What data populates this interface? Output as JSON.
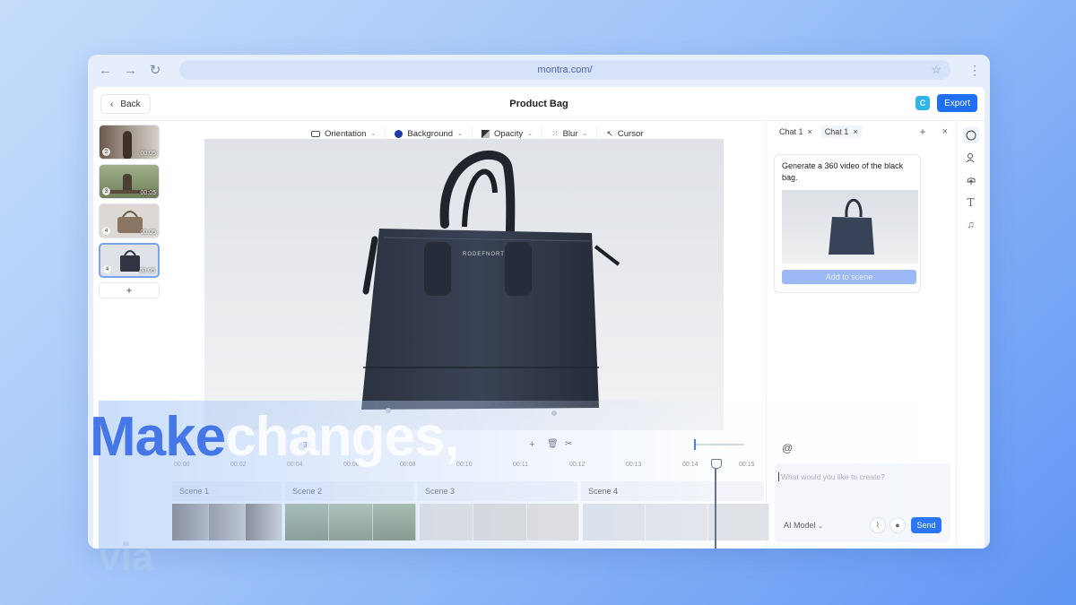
{
  "browser": {
    "url": "montra.com/"
  },
  "header": {
    "back_label": "Back",
    "title": "Product Bag",
    "badge_letter": "C",
    "export_label": "Export"
  },
  "scenes": [
    {
      "num": "2",
      "duration": "00:05"
    },
    {
      "num": "3",
      "duration": "00:05"
    },
    {
      "num": "4",
      "duration": "00:05"
    },
    {
      "num": "4",
      "duration": "00:05"
    }
  ],
  "scenes_add": "+",
  "toolbar": {
    "orientation": "Orientation",
    "background": "Background",
    "opacity": "Opacity",
    "blur": "Blur",
    "cursor": "Cursor"
  },
  "canvas": {
    "bag_brand": "RODEFNORT"
  },
  "chat": {
    "tabs": [
      {
        "label": "Chat 1"
      },
      {
        "label": "Chat 1"
      }
    ],
    "message": "Generate a 360 video of the black bag.",
    "add_to_scene": "Add to scene",
    "at_symbol": "@",
    "placeholder": "What would you like to create?",
    "model": "AI Model",
    "send": "Send"
  },
  "timeline": {
    "time_readout": "32",
    "ruler": [
      "00:00",
      "00:02",
      "00:04",
      "00:06",
      "00:08",
      "00:10",
      "00:11",
      "00:12",
      "00:13",
      "00:14",
      "00:15"
    ],
    "scenes": [
      "Scene 1",
      "Scene 2",
      "Scene 3",
      "Scene 4"
    ]
  },
  "overlay": {
    "word1": "Make",
    "word2": "changes,",
    "word3": "via"
  },
  "colors": {
    "accent": "#1f6ff2",
    "overlay_blue": "#4677e9"
  }
}
